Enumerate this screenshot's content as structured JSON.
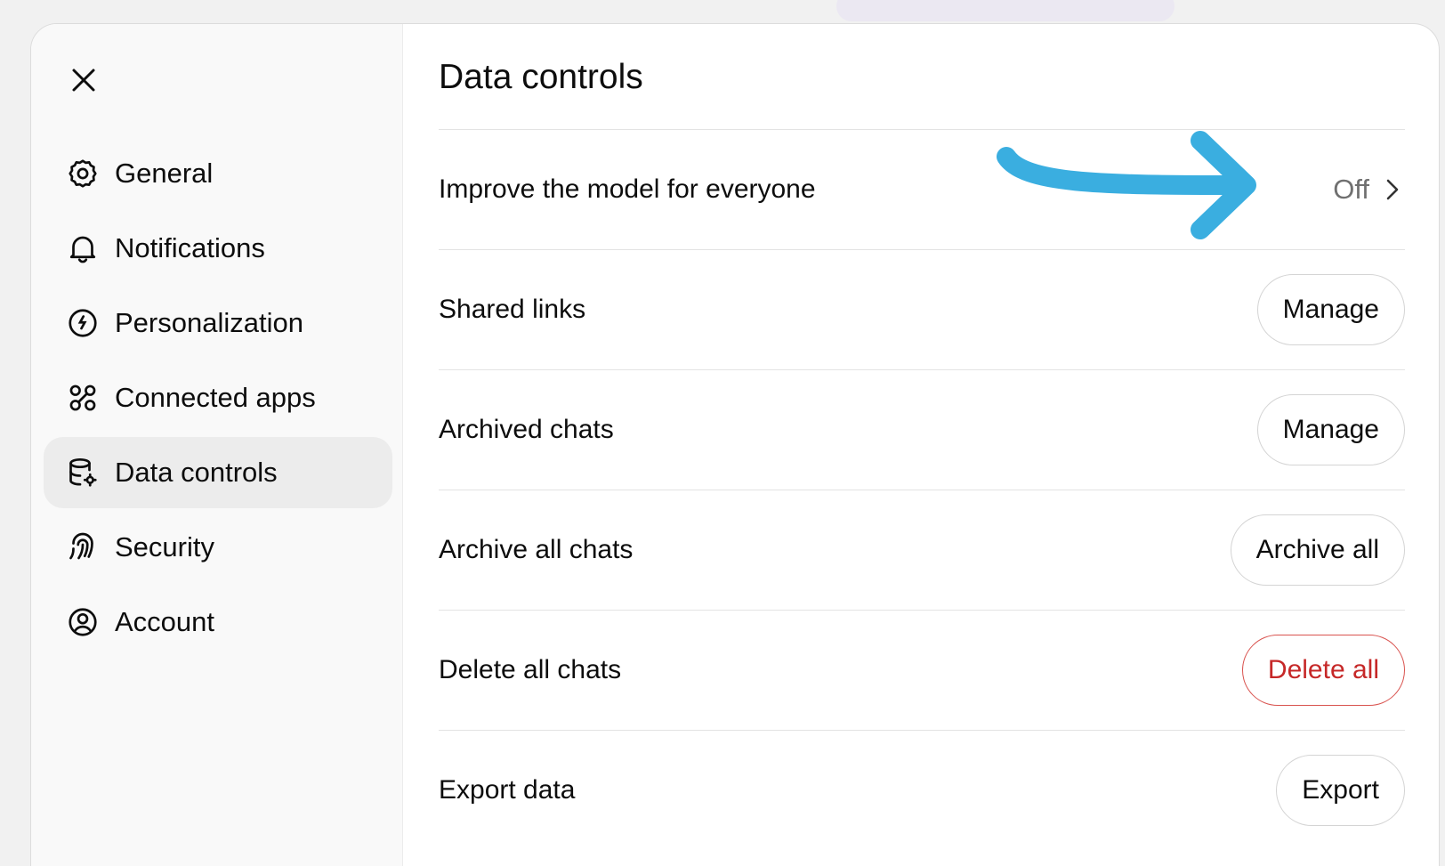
{
  "colors": {
    "accent_arrow": "#3aaee0",
    "danger": "#c62828",
    "active_nav_bg": "#ececec"
  },
  "sidebar": {
    "close_icon": "close-icon",
    "items": [
      {
        "label": "General",
        "icon": "gear-icon"
      },
      {
        "label": "Notifications",
        "icon": "bell-icon"
      },
      {
        "label": "Personalization",
        "icon": "personalization-icon"
      },
      {
        "label": "Connected apps",
        "icon": "apps-icon"
      },
      {
        "label": "Data controls",
        "icon": "database-gear-icon",
        "active": true
      },
      {
        "label": "Security",
        "icon": "fingerprint-icon"
      },
      {
        "label": "Account",
        "icon": "user-circle-icon"
      }
    ]
  },
  "main": {
    "title": "Data controls",
    "rows": [
      {
        "label": "Improve the model for everyone",
        "status": "Off"
      },
      {
        "label": "Shared links",
        "button": "Manage"
      },
      {
        "label": "Archived chats",
        "button": "Manage"
      },
      {
        "label": "Archive all chats",
        "button": "Archive all"
      },
      {
        "label": "Delete all chats",
        "button": "Delete all"
      },
      {
        "label": "Export data",
        "button": "Export"
      }
    ]
  }
}
